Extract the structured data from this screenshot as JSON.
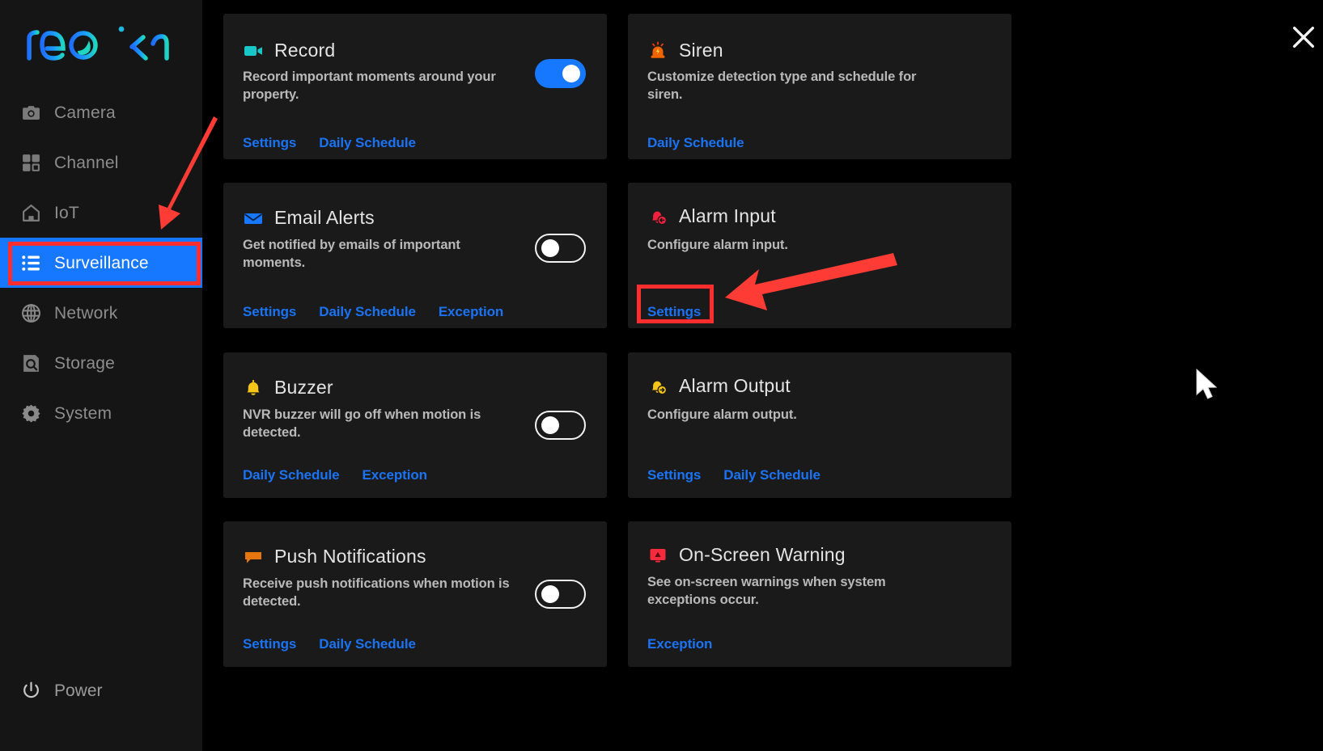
{
  "app": {
    "brand": "reolink",
    "close_label": "close-icon"
  },
  "sidebar": {
    "items": [
      {
        "label": "Camera",
        "icon": "camera-icon",
        "active": false
      },
      {
        "label": "Channel",
        "icon": "grid-icon",
        "active": false
      },
      {
        "label": "IoT",
        "icon": "home-icon",
        "active": false
      },
      {
        "label": "Surveillance",
        "icon": "list-icon",
        "active": true
      },
      {
        "label": "Network",
        "icon": "globe-icon",
        "active": false
      },
      {
        "label": "Storage",
        "icon": "hard-drive-icon",
        "active": false
      },
      {
        "label": "System",
        "icon": "gear-icon",
        "active": false
      }
    ],
    "power": {
      "label": "Power",
      "icon": "power-icon"
    }
  },
  "cards": [
    {
      "title": "Record",
      "desc": "Record important moments around your property.",
      "icon": "video-camera-icon",
      "icon_color": "#18c8c8",
      "toggle": "on",
      "links": [
        "Settings",
        "Daily Schedule"
      ]
    },
    {
      "title": "Siren",
      "desc": "Customize detection type and schedule for siren.",
      "icon": "siren-icon",
      "icon_color": "#f06400",
      "toggle": "none",
      "links": [
        "Daily Schedule"
      ]
    },
    {
      "title": "Email Alerts",
      "desc": "Get notified by emails of important moments.",
      "icon": "envelope-icon",
      "icon_color": "#1677ff",
      "toggle": "off",
      "links": [
        "Settings",
        "Daily Schedule",
        "Exception"
      ]
    },
    {
      "title": "Alarm Input",
      "desc": "Configure alarm input.",
      "icon": "bell-arrow-in-icon",
      "icon_color": "#f41f3d",
      "toggle": "none",
      "links": [
        "Settings"
      ]
    },
    {
      "title": "Buzzer",
      "desc": "NVR buzzer will go off when motion is detected.",
      "icon": "bell-icon",
      "icon_color": "#f5c518",
      "toggle": "off",
      "links": [
        "Daily Schedule",
        "Exception"
      ]
    },
    {
      "title": "Alarm Output",
      "desc": "Configure alarm output.",
      "icon": "bell-arrow-out-icon",
      "icon_color": "#f5c518",
      "toggle": "none",
      "links": [
        "Settings",
        "Daily Schedule"
      ]
    },
    {
      "title": "Push Notifications",
      "desc": "Receive push notifications when motion is detected.",
      "icon": "speech-bubble-icon",
      "icon_color": "#e8760f",
      "toggle": "off",
      "links": [
        "Settings",
        "Daily Schedule"
      ]
    },
    {
      "title": "On-Screen Warning",
      "desc": "See on-screen warnings when system exceptions occur.",
      "icon": "monitor-warning-icon",
      "icon_color": "#f42b3d",
      "toggle": "off",
      "links": [
        "Exception"
      ]
    }
  ],
  "annotations": {
    "highlight_color": "#ff2d2d",
    "arrow_to_surveillance": "red-arrow-icon",
    "arrow_to_alarm_input_settings": "red-arrow-icon",
    "highlighted_sidebar_item": "Surveillance",
    "highlighted_link": "Settings"
  },
  "colors": {
    "accent_blue": "#1677ff",
    "link_blue": "#1a73f5",
    "card_bg": "#1a1a1a",
    "sidebar_bg": "#151515",
    "page_bg": "#000000"
  }
}
